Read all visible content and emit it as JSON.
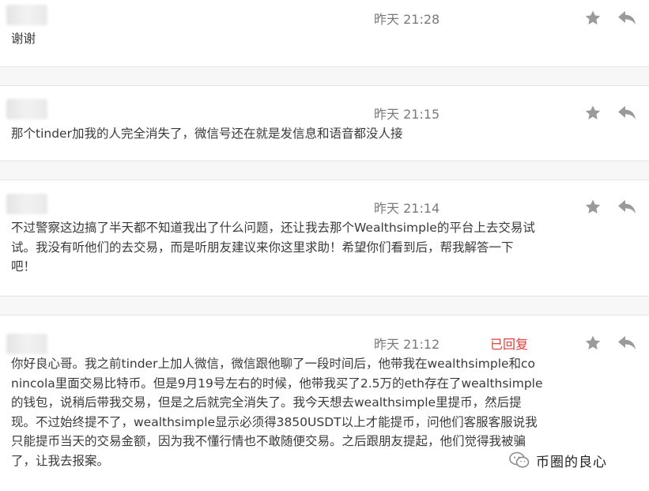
{
  "comments": [
    {
      "time": "昨天 21:28",
      "text": "谢谢",
      "replied": ""
    },
    {
      "time": "昨天 21:15",
      "text": "那个tinder加我的人完全消失了，微信号还在就是发信息和语音都没人接",
      "replied": ""
    },
    {
      "time": "昨天 21:14",
      "text": "不过警察这边搞了半天都不知道我出了什么问题，还让我去那个Wealthsimple的平台上去交易试\n试。我没有听他们的去交易，而是听朋友建议来你这里求助！希望你们看到后，帮我解答一下\n吧！",
      "replied": ""
    },
    {
      "time": "昨天 21:12",
      "text": "你好良心哥。我之前tinder上加人微信，微信跟他聊了一段时间后，他带我在wealthsimple和co\nnincola里面交易比特币。但是9月19号左右的时候，他带我买了2.5万的eth存在了wealthsimple\n的钱包，说稍后带我交易，但是之后就完全消失了。我今天想去wealthsimple里提币，然后提\n现。不过始终提不了，wealthsimple显示必须得3850USDT以上才能提币，问他们客服客服说我\n只能提币当天的交易金额，因为我不懂行情也不敢随便交易。之后跟朋友提起，他们觉得我被骗\n了，让我去报案。",
      "replied": "已回复"
    }
  ],
  "watermark": {
    "text": "币圈的良心"
  },
  "colors": {
    "star": "#9a9a9a",
    "reply": "#9a9a9a",
    "replied": "#e43d3d",
    "divider": "#e3e3e3"
  },
  "icons": {
    "favorite": "star-icon",
    "reply": "reply-arrow-icon",
    "watermark": "wechat-logo-icon"
  }
}
